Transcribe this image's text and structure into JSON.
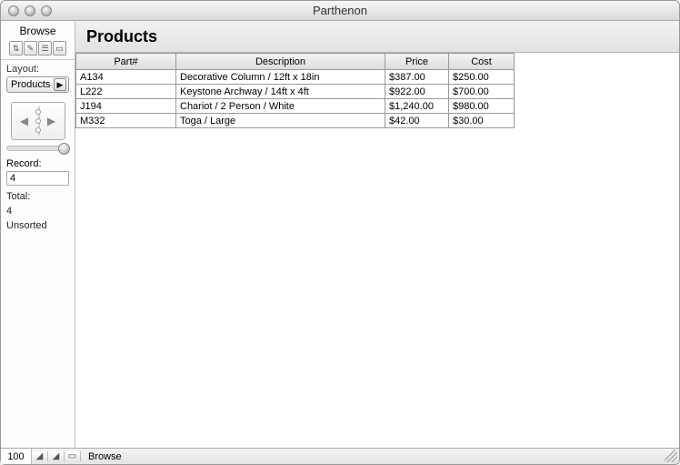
{
  "window": {
    "title": "Parthenon"
  },
  "sidebar": {
    "mode_label": "Browse",
    "layout_label": "Layout:",
    "layout_value": "Products",
    "record_label": "Record:",
    "record_value": "4",
    "total_label": "Total:",
    "total_value": "4",
    "sort_state": "Unsorted"
  },
  "header": {
    "title": "Products"
  },
  "table": {
    "columns": [
      "Part#",
      "Description",
      "Price",
      "Cost"
    ],
    "rows": [
      {
        "part": "A134",
        "desc": "Decorative Column / 12ft x 18in",
        "price": "$387.00",
        "cost": "$250.00"
      },
      {
        "part": "L222",
        "desc": "Keystone Archway / 14ft x 4ft",
        "price": "$922.00",
        "cost": "$700.00"
      },
      {
        "part": "J194",
        "desc": "Chariot / 2 Person / White",
        "price": "$1,240.00",
        "cost": "$980.00"
      },
      {
        "part": "M332",
        "desc": "Toga / Large",
        "price": "$42.00",
        "cost": "$30.00"
      }
    ]
  },
  "status": {
    "zoom": "100",
    "mode": "Browse"
  }
}
